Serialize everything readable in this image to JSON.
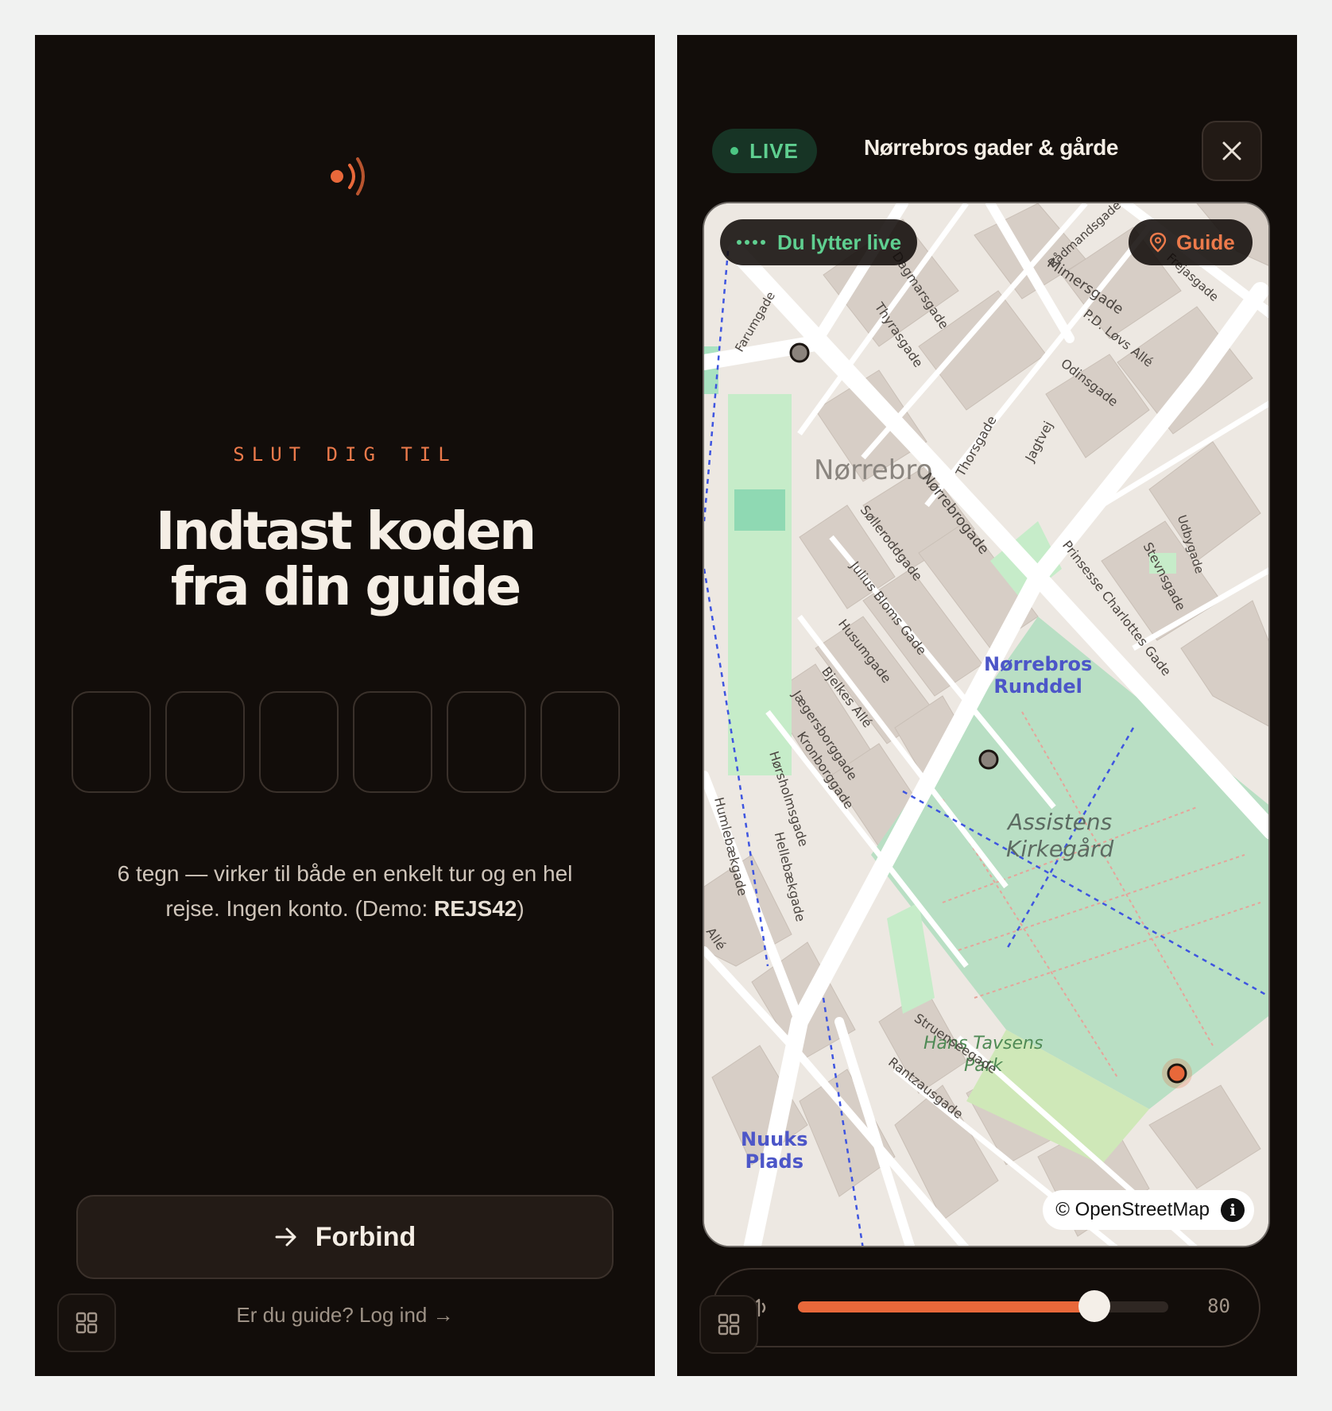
{
  "join": {
    "eyebrow": "SLUT DIG TIL",
    "heading_line1": "Indtast koden",
    "heading_line2": "fra din guide",
    "code_length": 6,
    "hint_text": "6 tegn — virker til både en enkelt tur og en hel rejse. Ingen konto. (Demo: ",
    "hint_demo_code": "REJS42",
    "hint_close": ")",
    "connect_label": "Forbind",
    "guide_login": "Er du guide? Log ind →"
  },
  "live_view": {
    "live_badge": "LIVE",
    "tour_title": "Nørrebros gader & gårde",
    "listening_badge": "Du lytter live",
    "guide_badge": "Guide",
    "attribution": "© OpenStreetMap",
    "volume": 80,
    "volume_label": "80",
    "map_labels": {
      "district": "Nørrebro",
      "rundel_1": "Nørrebros",
      "rundel_2": "Runddel",
      "cemetery_1": "Assistens",
      "cemetery_2": "Kirkegård",
      "park_1": "Hans Tavsens",
      "park_2": "Park",
      "plads_1": "Nuuks",
      "plads_2": "Plads"
    },
    "streets": {
      "s1": "Dagmarsgade",
      "s2": "Thyrasgade",
      "s3": "Mimersgade",
      "s4": "P.D. Løvs Allé",
      "s5": "Odinsgade",
      "s6": "Frejasgade",
      "s7": "Rådmandsgade",
      "s8": "Thorsgade",
      "s9": "Jagtvej",
      "s10": "Nørrebrogade",
      "s11": "Sølleroddgade",
      "s12": "Julius Bloms Gade",
      "s13": "Husumgade",
      "s14": "Bjelkes Allé",
      "s15": "Jægersborggade",
      "s16": "Kronborggade",
      "s17": "Hørsholmsgade",
      "s18": "Humlebækgade",
      "s19": "Hellebækgade",
      "s20": "Prinsesse Charlottes Gade",
      "s21": "Stevnsgade",
      "s22": "Struenseegade",
      "s23": "Rantzausgade",
      "s24": "Farumgade",
      "s25": "Udbygade",
      "s26": "Allé"
    }
  },
  "colors": {
    "accent": "#e8683a",
    "live_green": "#5fcf90",
    "background": "#120d0a"
  },
  "icons": {
    "brand": "broadcast-icon",
    "connect": "arrow-right-icon",
    "apps": "grid-icon",
    "close": "close-icon",
    "listening": "audio-dots-icon",
    "guide": "location-pin-icon",
    "volume": "speaker-icon",
    "info": "info-icon"
  }
}
